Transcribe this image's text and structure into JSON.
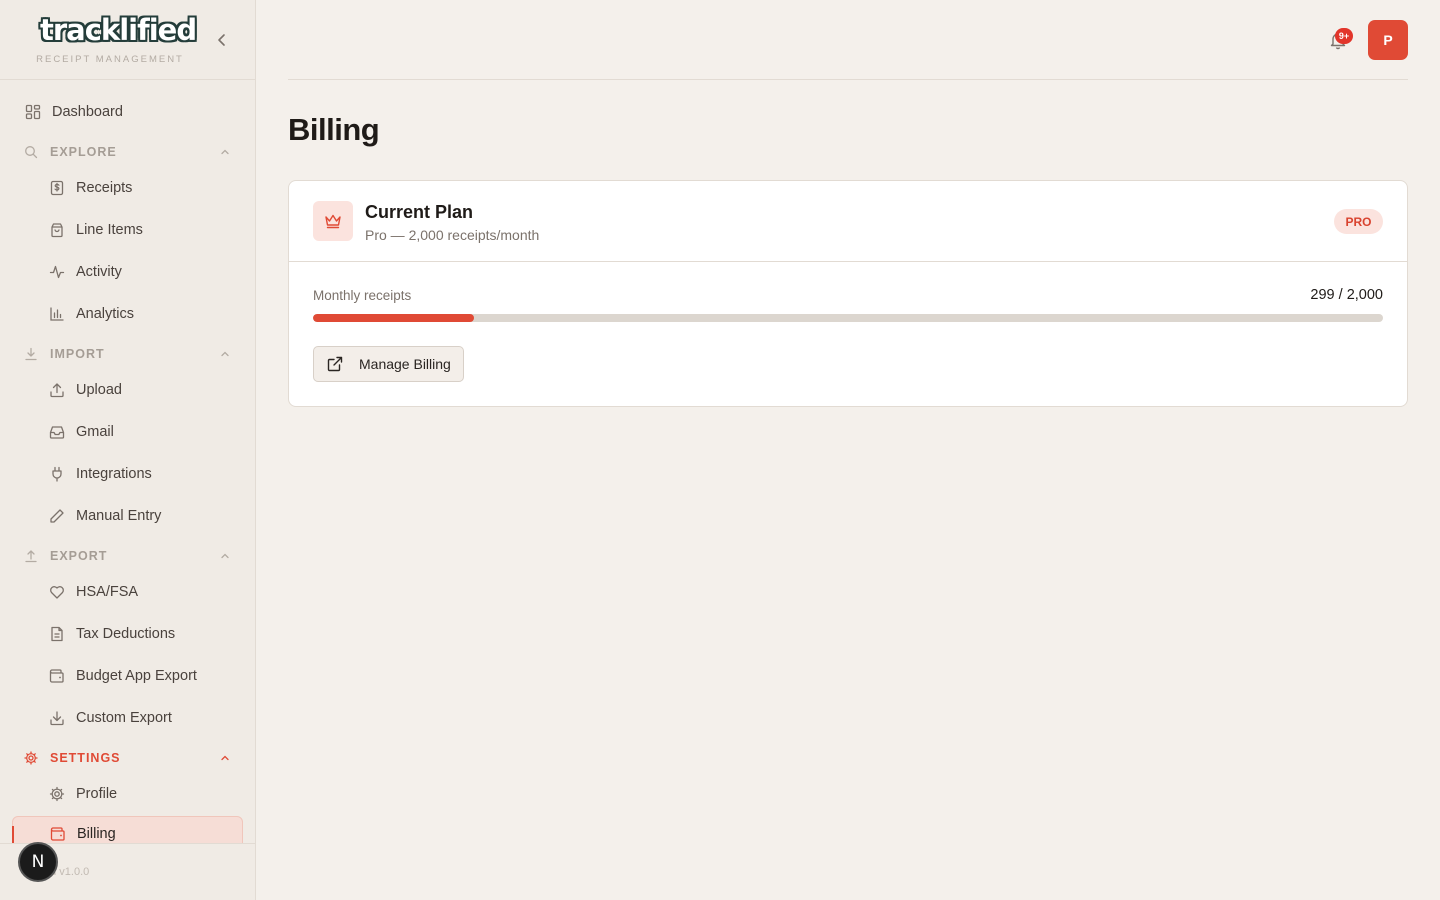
{
  "brand": {
    "logo_text": "tracklified",
    "tagline": "RECEIPT MANAGEMENT"
  },
  "sidebar": {
    "dashboard": "Dashboard",
    "sections": {
      "explore": {
        "label": "EXPLORE",
        "items": [
          "Receipts",
          "Line Items",
          "Activity",
          "Analytics"
        ]
      },
      "import": {
        "label": "IMPORT",
        "items": [
          "Upload",
          "Gmail",
          "Integrations",
          "Manual Entry"
        ]
      },
      "export": {
        "label": "EXPORT",
        "items": [
          "HSA/FSA",
          "Tax Deductions",
          "Budget App Export",
          "Custom Export"
        ]
      },
      "settings": {
        "label": "SETTINGS",
        "items": [
          "Profile",
          "Billing"
        ]
      }
    },
    "active_item": "Billing",
    "version": "ed v1.0.0",
    "dev_badge": "N"
  },
  "header": {
    "notification_count": "9+",
    "avatar_initial": "P"
  },
  "page": {
    "title": "Billing"
  },
  "plan_card": {
    "title": "Current Plan",
    "subtitle": "Pro — 2,000 receipts/month",
    "badge": "PRO",
    "usage_label": "Monthly receipts",
    "usage_count": "299 / 2,000",
    "usage_fraction": 0.15,
    "manage_button": "Manage Billing"
  },
  "colors": {
    "accent": "#e04a35",
    "background": "#f4f0eb",
    "sidebar": "#f0ebe5"
  },
  "icons": {
    "dashboard": "layout-grid-icon",
    "explore": "search-icon",
    "receipts": "dollar-receipt-icon",
    "line_items": "shopping-bag-icon",
    "activity": "pulse-icon",
    "analytics": "bar-chart-icon",
    "import": "download-icon",
    "upload": "upload-icon",
    "gmail": "inbox-icon",
    "integrations": "plug-icon",
    "manual_entry": "pencil-icon",
    "export": "upload-arrow-icon",
    "hsa_fsa": "heart-icon",
    "tax": "document-icon",
    "budget": "wallet-icon",
    "custom_export": "download-icon",
    "settings": "gear-icon",
    "profile": "gear-icon",
    "billing": "wallet-icon",
    "plan": "crown-icon",
    "manage": "external-link-icon",
    "notifications": "bell-icon",
    "collapse": "chevron-left-icon"
  }
}
